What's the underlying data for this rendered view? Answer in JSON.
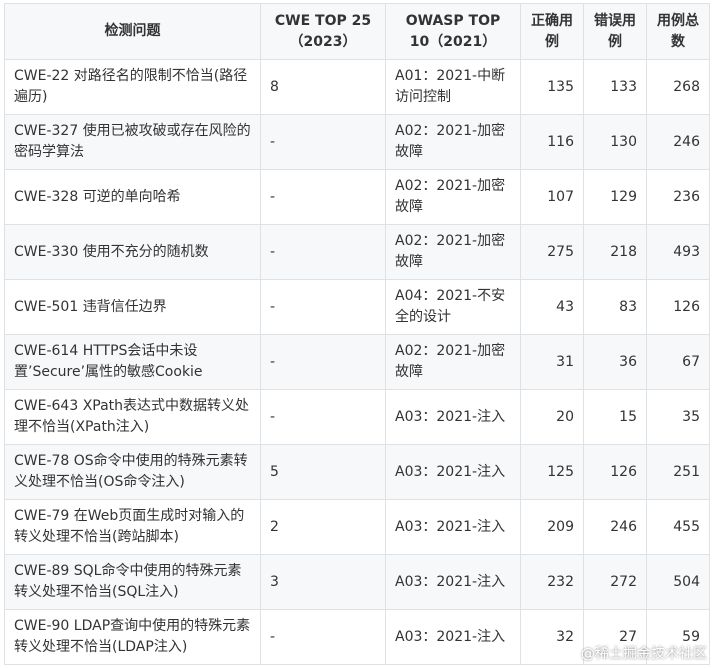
{
  "headers": [
    "检测问题",
    "CWE TOP 25（2023）",
    "OWASP TOP 10（2021）",
    "正确用例",
    "错误用例",
    "用例总数"
  ],
  "rows": [
    [
      "CWE-22 对路径名的限制不恰当(路径遍历)",
      "8",
      "A01：2021-中断访问控制",
      "135",
      "133",
      "268"
    ],
    [
      "CWE-327 使用已被攻破或存在风险的密码学算法",
      "-",
      "A02：2021-加密故障",
      "116",
      "130",
      "246"
    ],
    [
      "CWE-328 可逆的单向哈希",
      "-",
      "A02：2021-加密故障",
      "107",
      "129",
      "236"
    ],
    [
      "CWE-330 使用不充分的随机数",
      "-",
      "A02：2021-加密故障",
      "275",
      "218",
      "493"
    ],
    [
      "CWE-501 违背信任边界",
      "-",
      "A04：2021-不安全的设计",
      "43",
      "83",
      "126"
    ],
    [
      "CWE-614 HTTPS会话中未设置’Secure’属性的敏感Cookie",
      "-",
      "A02：2021-加密故障",
      "31",
      "36",
      "67"
    ],
    [
      "CWE-643 XPath表达式中数据转义处理不恰当(XPath注入)",
      "-",
      "A03：2021-注入",
      "20",
      "15",
      "35"
    ],
    [
      "CWE-78 OS命令中使用的特殊元素转义处理不恰当(OS命令注入)",
      "5",
      "A03：2021-注入",
      "125",
      "126",
      "251"
    ],
    [
      "CWE-79 在Web页面生成时对输入的转义处理不恰当(跨站脚本)",
      "2",
      "A03：2021-注入",
      "209",
      "246",
      "455"
    ],
    [
      "CWE-89 SQL命令中使用的特殊元素转义处理不恰当(SQL注入)",
      "3",
      "A03：2021-注入",
      "232",
      "272",
      "504"
    ],
    [
      "CWE-90 LDAP查询中使用的特殊元素转义处理不恰当(LDAP注入)",
      "-",
      "A03：2021-注入",
      "32",
      "27",
      "59"
    ]
  ],
  "watermark": "@稀土掘金技术社区"
}
